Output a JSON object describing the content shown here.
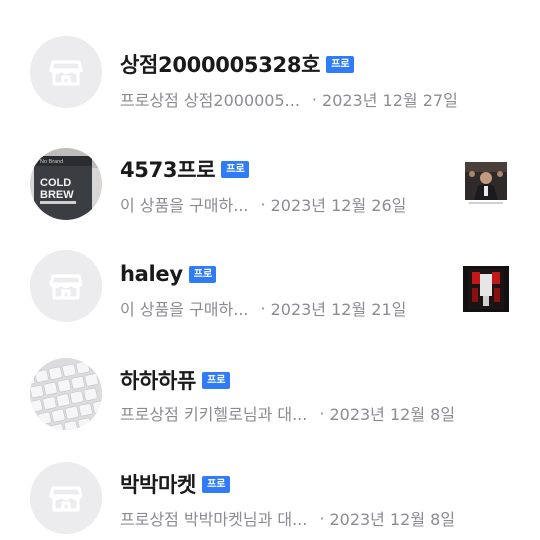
{
  "chats": [
    {
      "name": "",
      "badge": "",
      "preview": "",
      "separator": "",
      "date": ""
    },
    {
      "name": "상점2000005328호",
      "badge": "프로",
      "preview": "프로상점 상점2000005...",
      "separator": "·",
      "date": "2023년 12월 27일",
      "avatar": "store-icon"
    },
    {
      "name": "4573프로",
      "badge": "프로",
      "preview": "이 상품을 구매하...",
      "separator": "·",
      "date": "2023년 12월 26일",
      "avatar": "cold-brew-photo",
      "avatar_text": [
        "COLD",
        "BREW"
      ],
      "avatar_brand": "No Brand",
      "thumbnail": "product-photo"
    },
    {
      "name": "haley",
      "badge": "프로",
      "preview": "이 상품을 구매하...",
      "separator": "·",
      "date": "2023년 12월 21일",
      "avatar": "store-icon",
      "thumbnail": "poster-photo"
    },
    {
      "name": "하하하퓨",
      "badge": "프로",
      "preview": "프로상점 키키헬로님과 대...",
      "separator": "·",
      "date": "2023년 12월 8일",
      "avatar": "keyboard-photo"
    },
    {
      "name": "박박마켓",
      "badge": "프로",
      "preview": "프로상점 박박마켓님과 대...",
      "separator": "·",
      "date": "2023년 12월 8일",
      "avatar": "store-icon"
    }
  ],
  "colors": {
    "badge": "#2f7cf6",
    "name": "#1a1a1a",
    "meta": "#8c8c92",
    "avatar_bg": "#ececee"
  }
}
